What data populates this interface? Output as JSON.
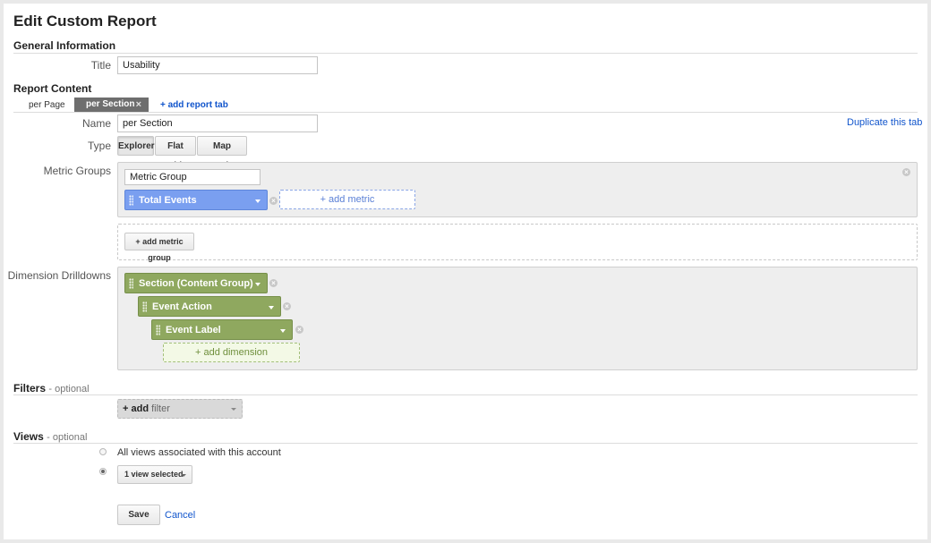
{
  "page": {
    "title": "Edit Custom Report"
  },
  "general": {
    "heading": "General Information",
    "title_label": "Title",
    "title_value": "Usability"
  },
  "report_content": {
    "heading": "Report Content",
    "tabs": [
      {
        "label": "per Page",
        "selected": false
      },
      {
        "label": "per Section",
        "selected": true
      }
    ],
    "tab_close": "×",
    "add_tab": "+ add report tab",
    "duplicate": "Duplicate this tab",
    "name_label": "Name",
    "name_value": "per Section",
    "type_label": "Type",
    "types": [
      "Explorer",
      "Flat Table",
      "Map Overlay"
    ],
    "type_selected": "Explorer"
  },
  "metric_groups": {
    "label": "Metric Groups",
    "group_name": "Metric Group",
    "metrics": [
      "Total Events"
    ],
    "add_metric": "+ add metric",
    "add_group": "+ add metric group"
  },
  "dimension_drilldowns": {
    "label": "Dimension Drilldowns",
    "items": [
      "Section (Content Group)",
      "Event Action",
      "Event Label"
    ],
    "add_dimension": "+ add dimension"
  },
  "filters": {
    "heading": "Filters",
    "optional": "- optional",
    "add_prefix": "+ add",
    "add_word": "filter"
  },
  "views": {
    "heading": "Views",
    "optional": "- optional",
    "option_all": "All views associated with this account",
    "selected_label": "1 view selected"
  },
  "actions": {
    "save": "Save",
    "cancel": "Cancel"
  },
  "colors": {
    "metric": "#7a9ff0",
    "dimension": "#8fa85f",
    "link": "#1155cc",
    "selected_tab": "#6e6e6e"
  },
  "icons": {
    "remove": "close-circle-icon",
    "grip": "drag-grip-icon",
    "dropdown": "chevron-down-icon"
  }
}
